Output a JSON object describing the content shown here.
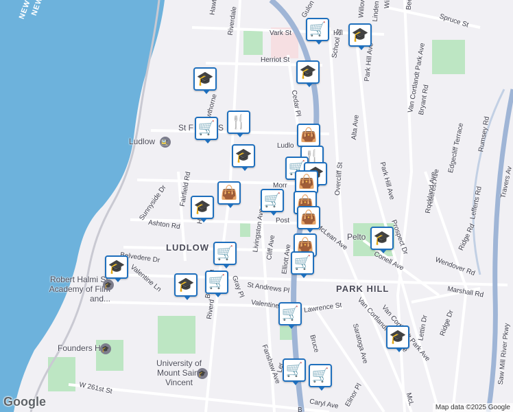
{
  "colors": {
    "water": "#6db2dc",
    "land": "#f1f0f4",
    "road": "#ffffff",
    "highway": "#9fb5d6",
    "park": "#bde6c3",
    "pin_border": "#1e6fbd"
  },
  "river_labels": [
    "NEW",
    "NEW"
  ],
  "streets": [
    "Vark St",
    "Hill",
    "Herriot St",
    "School St",
    "Cedar Pl",
    "Ludlo",
    "St F",
    "S",
    "Morr",
    "Post",
    "Ashton Rd",
    "Sunnyside Dr",
    "Fairfield Rd",
    "Hawt Ave",
    "Hawthorne",
    "Riverdale",
    "Livingston Ave",
    "Cliff Ave",
    "Elliott Ave",
    "McLean Ave",
    "Belvedere Dr",
    "Valentine Ln",
    "Gray Pl",
    "St Andrews Pl",
    "Valentine",
    "Lawrence St",
    "Van Cortlandt Park Ave",
    "Saratoga Ave",
    "Bruce",
    "Fanshaw Ave",
    "Elinor Pl",
    "Caryl Ave",
    "W 261st St",
    "Riverd",
    "Ler",
    "Park Hill Ave",
    "Park Hill Ave",
    "Alta Ave",
    "Overcliff St",
    "Bryant Rd",
    "Hillcrest Ave",
    "Rockland Ave",
    "Edgecliff Terrace",
    "Rumsey Rd",
    "Lefferts Rd",
    "Travers Av",
    "Prospect Dr",
    "Ridge Rd",
    "Wendover Rd",
    "Marshall Rd",
    "Ridge Dr",
    "Lettin Dr",
    "Saw Mill River Pkwy",
    "Spruce St",
    "Gulon",
    "Conell Ave",
    "Pelto",
    "Van Cortlandt Park Ave",
    "Van Cortlandt Park Ave",
    "McL",
    "Wil",
    "Ba",
    "Ba",
    "Bee",
    "Linden St",
    "Willow St",
    "Hawt",
    "B"
  ],
  "neighborhoods": [
    "LUDLOW",
    "PARK HILL"
  ],
  "places": [
    {
      "label": "Ludlow",
      "icon": "train-station-icon"
    },
    {
      "label": "Robert Halmi Sr. Academy of Film and...",
      "icon": "school-icon"
    },
    {
      "label": "Founders Hall",
      "icon": "school-icon"
    },
    {
      "label": "University of Mount Saint Vincent",
      "icon": "school-icon"
    }
  ],
  "pins": [
    {
      "type": "cart",
      "glyph": "🛒"
    },
    {
      "type": "school",
      "glyph": "🎓"
    },
    {
      "type": "school",
      "glyph": "🎓"
    },
    {
      "type": "school",
      "glyph": "🎓"
    },
    {
      "type": "cart",
      "glyph": "🛒"
    },
    {
      "type": "restaurant",
      "glyph": "🍴"
    },
    {
      "type": "bag",
      "glyph": "👜"
    },
    {
      "type": "school",
      "glyph": "🎓"
    },
    {
      "type": "restaurant",
      "glyph": "🍴"
    },
    {
      "type": "cart",
      "glyph": "🛒"
    },
    {
      "type": "school",
      "glyph": "🎓"
    },
    {
      "type": "bag",
      "glyph": "👜"
    },
    {
      "type": "bag",
      "glyph": "👜"
    },
    {
      "type": "bag",
      "glyph": "👜"
    },
    {
      "type": "bag",
      "glyph": "👜"
    },
    {
      "type": "cart",
      "glyph": "🛒"
    },
    {
      "type": "cart",
      "glyph": "🛒"
    },
    {
      "type": "school",
      "glyph": "🎓"
    },
    {
      "type": "school",
      "glyph": "🎓"
    },
    {
      "type": "cart",
      "glyph": "🛒"
    },
    {
      "type": "school",
      "glyph": "🎓"
    },
    {
      "type": "cart",
      "glyph": "🛒"
    },
    {
      "type": "cart",
      "glyph": "🛒"
    },
    {
      "type": "school",
      "glyph": "🎓"
    },
    {
      "type": "cart",
      "glyph": "🛒"
    },
    {
      "type": "cart",
      "glyph": "🛒"
    }
  ],
  "google_logo": "Google",
  "attribution": "Map data ©2025 Google"
}
